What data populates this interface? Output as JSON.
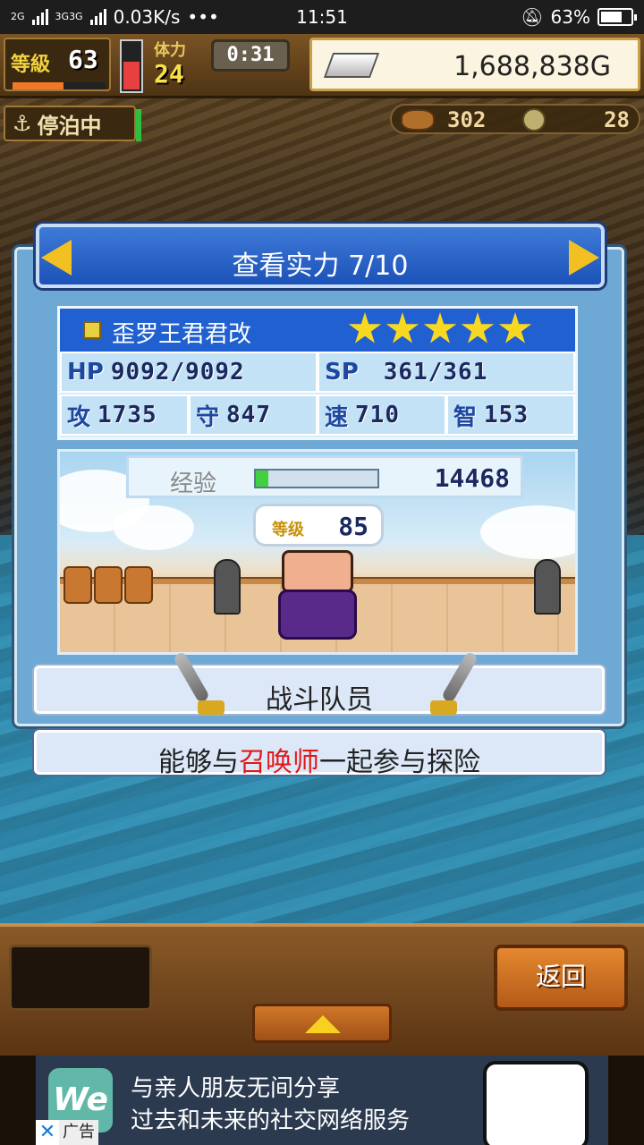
{
  "status_bar": {
    "network_1": "2G",
    "network_2": "3G",
    "network_3": "3G",
    "speed": "0.03K/s",
    "dots": "•••",
    "time": "11:51",
    "battery": "63%",
    "battery_level": 0.63
  },
  "hud": {
    "level_label": "等級",
    "level_value": "63",
    "level_progress": 0.55,
    "stamina_label": "体力",
    "stamina_value": "24",
    "stamina_fill": 0.55,
    "timer": "0:31",
    "gold": "1,688,838G",
    "anchor_status": "停泊中",
    "resource_1": "302",
    "resource_2": "28"
  },
  "panel": {
    "title": "查看实力 7/10",
    "character_name": "歪罗王君君改",
    "stars": 5,
    "stats": {
      "hp_label": "HP",
      "hp_value": "9092/9092",
      "sp_label": "SP",
      "sp_value": "361/361",
      "atk_label": "攻",
      "atk_value": "1735",
      "def_label": "守",
      "def_value": "847",
      "spd_label": "速",
      "spd_value": "710",
      "int_label": "智",
      "int_value": "153"
    },
    "xp_label": "经验",
    "xp_value": "14468",
    "xp_progress": 0.1,
    "char_level_label": "等级",
    "char_level_value": "85",
    "role": "战斗队员",
    "description_prefix": "能够与",
    "description_highlight": "召唤师",
    "description_suffix": "一起参与探险"
  },
  "bottom": {
    "back_label": "返回"
  },
  "ad": {
    "logo_text": "We",
    "line1": "与亲人朋友无间分享",
    "line2": "过去和未来的社交网络服务",
    "close": "✕",
    "tag": "广告"
  }
}
